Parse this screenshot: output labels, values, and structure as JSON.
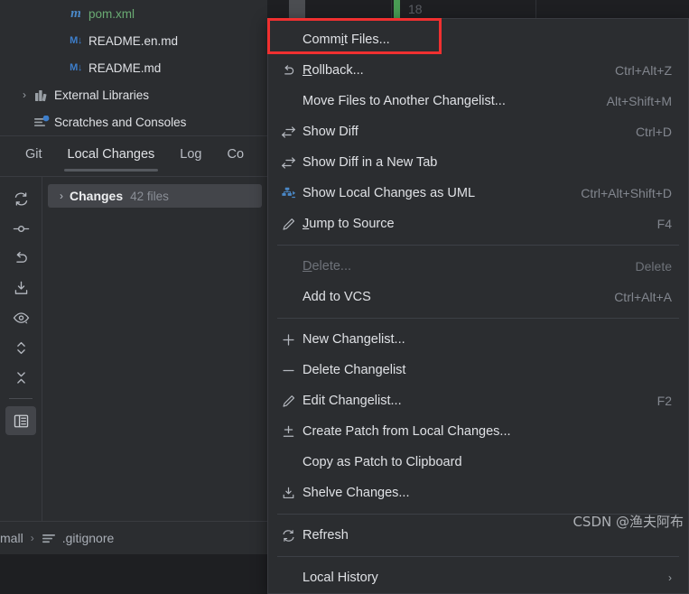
{
  "editor_strip": {
    "line_number": "18"
  },
  "project_tree": {
    "items": [
      {
        "label": "pom.xml",
        "icon": "maven-icon",
        "icon_text": "m",
        "chevron": "",
        "style": "pom"
      },
      {
        "label": "README.en.md",
        "icon": "markdown-icon",
        "icon_text": "M↓",
        "chevron": "",
        "style": ""
      },
      {
        "label": "README.md",
        "icon": "markdown-icon",
        "icon_text": "M↓",
        "chevron": "",
        "style": ""
      },
      {
        "label": "External Libraries",
        "icon": "library-icon",
        "icon_text": "",
        "chevron": "›",
        "style": ""
      },
      {
        "label": "Scratches and Consoles",
        "icon": "scratches-icon",
        "icon_text": "",
        "chevron": "",
        "style": ""
      }
    ]
  },
  "tool_window": {
    "tabs": [
      {
        "label": "Git",
        "active": false
      },
      {
        "label": "Local Changes",
        "active": true
      },
      {
        "label": "Log",
        "active": false
      },
      {
        "label": "Co",
        "active": false
      }
    ],
    "toolbar_buttons": [
      {
        "name": "refresh-icon"
      },
      {
        "name": "commit-node-icon"
      },
      {
        "name": "rollback-icon"
      },
      {
        "name": "shelve-icon"
      },
      {
        "name": "preview-diff-icon"
      },
      {
        "name": "expand-collapse-icon"
      },
      {
        "name": "collapse-all-icon"
      },
      {
        "name": "group-by-icon",
        "selected": true
      }
    ],
    "changes_node": {
      "chevron": "›",
      "title": "Changes",
      "count": "42 files"
    }
  },
  "context_menu": {
    "items": [
      {
        "type": "item",
        "label": "Commit Files...",
        "mnemonic": "i",
        "shortcut": "",
        "icon": "",
        "disabled": false,
        "highlighted": true
      },
      {
        "type": "item",
        "label": "Rollback...",
        "mnemonic": "R",
        "shortcut": "Ctrl+Alt+Z",
        "icon": "rollback-icon",
        "disabled": false
      },
      {
        "type": "item",
        "label": "Move Files to Another Changelist...",
        "mnemonic": "",
        "shortcut": "Alt+Shift+M",
        "icon": "",
        "disabled": false
      },
      {
        "type": "item",
        "label": "Show Diff",
        "mnemonic": "",
        "shortcut": "Ctrl+D",
        "icon": "show-diff-icon",
        "disabled": false
      },
      {
        "type": "item",
        "label": "Show Diff in a New Tab",
        "mnemonic": "",
        "shortcut": "",
        "icon": "show-diff-icon",
        "disabled": false
      },
      {
        "type": "item",
        "label": "Show Local Changes as UML",
        "mnemonic": "",
        "shortcut": "Ctrl+Alt+Shift+D",
        "icon": "uml-icon",
        "disabled": false
      },
      {
        "type": "item",
        "label": "Jump to Source",
        "mnemonic": "J",
        "shortcut": "F4",
        "icon": "edit-pencil-icon",
        "disabled": false
      },
      {
        "type": "separator"
      },
      {
        "type": "item",
        "label": "Delete...",
        "mnemonic": "D",
        "shortcut": "Delete",
        "icon": "",
        "disabled": true
      },
      {
        "type": "item",
        "label": "Add to VCS",
        "mnemonic": "",
        "shortcut": "Ctrl+Alt+A",
        "icon": "",
        "disabled": false
      },
      {
        "type": "separator"
      },
      {
        "type": "item",
        "label": "New Changelist...",
        "mnemonic": "",
        "shortcut": "",
        "icon": "plus-icon",
        "disabled": false
      },
      {
        "type": "item",
        "label": "Delete Changelist",
        "mnemonic": "",
        "shortcut": "",
        "icon": "minus-icon",
        "disabled": false
      },
      {
        "type": "item",
        "label": "Edit Changelist...",
        "mnemonic": "",
        "shortcut": "F2",
        "icon": "edit-pencil-icon",
        "disabled": false
      },
      {
        "type": "item",
        "label": "Create Patch from Local Changes...",
        "mnemonic": "",
        "shortcut": "",
        "icon": "create-patch-icon",
        "disabled": false
      },
      {
        "type": "item",
        "label": "Copy as Patch to Clipboard",
        "mnemonic": "",
        "shortcut": "",
        "icon": "",
        "disabled": false
      },
      {
        "type": "item",
        "label": "Shelve Changes...",
        "mnemonic": "",
        "shortcut": "",
        "icon": "shelve-icon",
        "disabled": false
      },
      {
        "type": "separator"
      },
      {
        "type": "item",
        "label": "Refresh",
        "mnemonic": "",
        "shortcut": "",
        "icon": "refresh-icon",
        "disabled": false
      },
      {
        "type": "separator"
      },
      {
        "type": "item",
        "label": "Local History",
        "mnemonic": "",
        "shortcut": "",
        "icon": "",
        "disabled": false,
        "submenu": true
      }
    ]
  },
  "status_bar": {
    "breadcrumb": [
      {
        "label": "ulimall",
        "icon": ""
      },
      {
        "label": ".gitignore",
        "icon": "file-text-icon"
      }
    ],
    "separator": "›"
  },
  "watermark": {
    "text": "CSDN @渔夫阿布"
  },
  "colors": {
    "panel_bg": "#2b2d30",
    "editor_bg": "#1e1f22",
    "highlight_red": "#f03030",
    "accent_blue": "#3d7ecb",
    "selection_bg": "#43454a",
    "green": "#499c54"
  }
}
